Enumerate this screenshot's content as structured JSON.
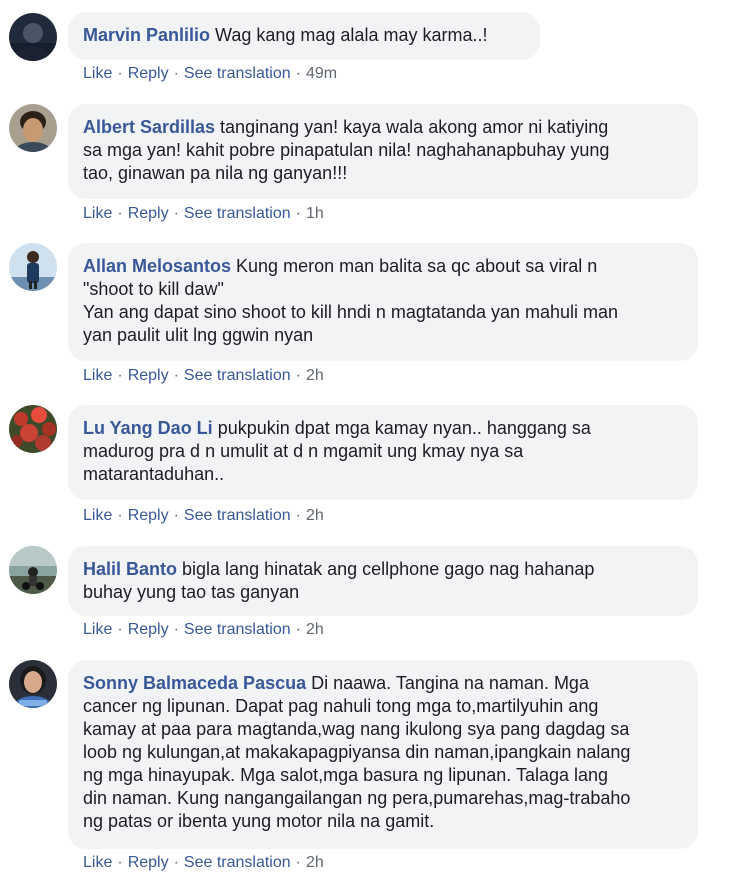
{
  "comments": [
    {
      "author": "Marvin Panlilio",
      "lines": [
        "Wag kang mag alala may karma..!"
      ],
      "actions": {
        "like": "Like",
        "reply": "Reply",
        "translate": "See translation",
        "time": "49m"
      },
      "sep": "·"
    },
    {
      "author": "Albert Sardillas",
      "lines": [
        "tanginang yan! kaya wala akong amor ni katiying",
        "sa mga yan! kahit pobre pinapatulan nila! naghahanapbuhay yung",
        "tao, ginawan pa nila ng ganyan!!!"
      ],
      "actions": {
        "like": "Like",
        "reply": "Reply",
        "translate": "See translation",
        "time": "1h"
      },
      "sep": "·"
    },
    {
      "author": "Allan Melosantos",
      "lines": [
        "Kung meron man balita sa qc about sa viral n",
        "\"shoot to kill daw\"",
        "Yan ang dapat sino shoot to kill hndi n magtatanda yan mahuli man",
        "yan paulit ulit lng ggwin nyan"
      ],
      "actions": {
        "like": "Like",
        "reply": "Reply",
        "translate": "See translation",
        "time": "2h"
      },
      "sep": "·"
    },
    {
      "author": "Lu Yang Dao Li",
      "lines": [
        "pukpukin dpat mga kamay nyan.. hanggang sa",
        "madurog pra d n umulit at d n mgamit ung kmay nya sa",
        "matarantaduhan.."
      ],
      "actions": {
        "like": "Like",
        "reply": "Reply",
        "translate": "See translation",
        "time": "2h"
      },
      "sep": "·"
    },
    {
      "author": "Halil Banto",
      "lines": [
        "bigla lang hinatak ang cellphone gago nag hahanap",
        "buhay yung tao tas ganyan"
      ],
      "actions": {
        "like": "Like",
        "reply": "Reply",
        "translate": "See translation",
        "time": "2h"
      },
      "sep": "·"
    },
    {
      "author": "Sonny Balmaceda Pascua",
      "lines": [
        "Di naawa. Tangina na naman. Mga",
        "cancer ng lipunan. Dapat pag nahuli tong mga to,martilyuhin ang",
        "kamay at paa para magtanda,wag nang ikulong sya pang dagdag sa",
        "loob ng kulungan,at makakapagpiyansa din naman,ipangkain nalang",
        "ng mga hinayupak. Mga salot,mga basura ng lipunan. Talaga lang",
        "din naman. Kung nangangailangan ng pera,pumarehas,mag-trabaho",
        "ng patas or ibenta yung motor nila na gamit."
      ],
      "actions": {
        "like": "Like",
        "reply": "Reply",
        "translate": "See translation",
        "time": "2h"
      },
      "sep": "·"
    }
  ]
}
